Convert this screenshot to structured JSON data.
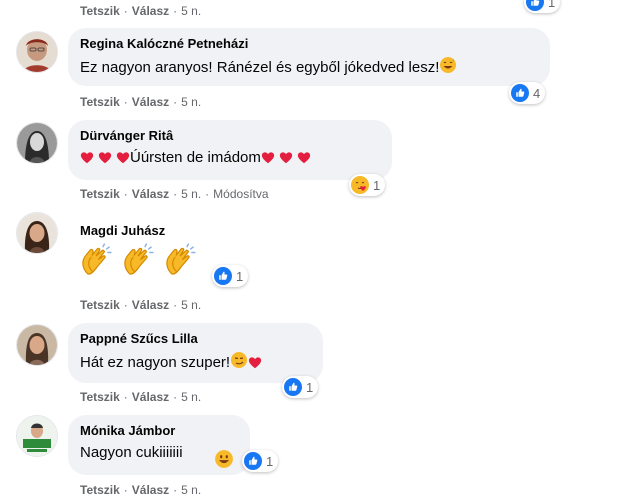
{
  "common": {
    "like": "Tetszik",
    "reply": "Válasz",
    "sep": "·"
  },
  "top_row": {
    "time": "5 n.",
    "reaction_count": "1"
  },
  "comments": [
    {
      "author": "Regina Kalóczné Petneházi",
      "text": "Ez nagyon aranyos! Ránézel és egyből jókedved lesz!",
      "time": "5 n.",
      "reaction_count": "4",
      "reaction_icon": "like-icon"
    },
    {
      "author": "Dürvánger Ritâ",
      "text": "Úúrsten de imádom",
      "time": "5 n.",
      "edited": "Módosítva",
      "reaction_count": "1",
      "reaction_icon": "care-icon"
    },
    {
      "author": "Magdi Juhász",
      "text": "",
      "time": "5 n.",
      "reaction_count": "1",
      "reaction_icon": "like-icon"
    },
    {
      "author": "Pappné Szűcs Lilla",
      "text": "Hát ez nagyon szuper!",
      "time": "5 n.",
      "reaction_count": "1",
      "reaction_icon": "like-icon"
    },
    {
      "author": "Mónika Jámbor",
      "text": "Nagyon cukiiiiiii",
      "time": "5 n.",
      "reaction_count": "1",
      "reaction_icon": "like-icon"
    }
  ],
  "colors": {
    "like_blue": "#1877f2",
    "bubble_bg": "#f0f2f5",
    "meta_grey": "#65676b",
    "heart_red": "#e41e3f",
    "emoji_yellow": "#f7b928"
  }
}
